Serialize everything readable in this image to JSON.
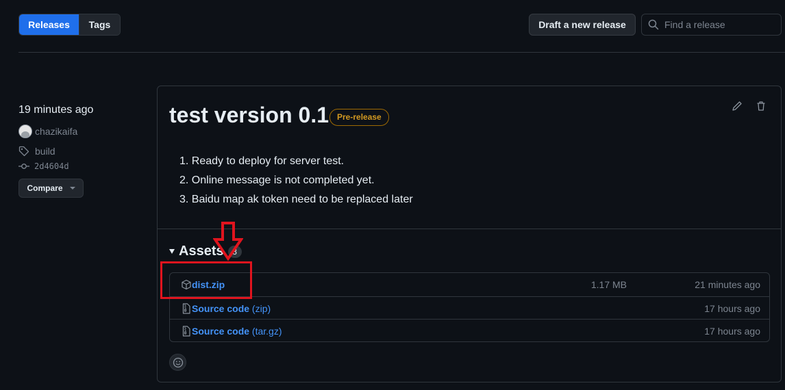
{
  "header": {
    "tabs": [
      {
        "label": "Releases",
        "active": true
      },
      {
        "label": "Tags",
        "active": false
      }
    ],
    "draft_button": "Draft a new release",
    "search_placeholder": "Find a release"
  },
  "sidebar": {
    "time": "19 minutes ago",
    "author": "chazikaifa",
    "tag": "build",
    "commit": "2d4604d",
    "compare_label": "Compare"
  },
  "release": {
    "title": "test version 0.1",
    "badge": "Pre-release",
    "notes": [
      "1. Ready to deploy for server test.",
      "2. Online message is not completed yet.",
      "3. Baidu map ak token need to be replaced later"
    ],
    "assets_title": "Assets",
    "assets_count": "3",
    "assets": [
      {
        "name": "dist.zip",
        "format": "",
        "size": "1.17 MB",
        "date": "21 minutes ago",
        "icon": "package-icon"
      },
      {
        "name": "Source code",
        "format": "(zip)",
        "size": "",
        "date": "17 hours ago",
        "icon": "file-zip-icon"
      },
      {
        "name": "Source code",
        "format": "(tar.gz)",
        "size": "",
        "date": "17 hours ago",
        "icon": "file-zip-icon"
      }
    ]
  },
  "colors": {
    "accent": "#1f6feb",
    "link": "#4493f8",
    "prerelease": "#d29922",
    "annotation": "#e0141e"
  }
}
